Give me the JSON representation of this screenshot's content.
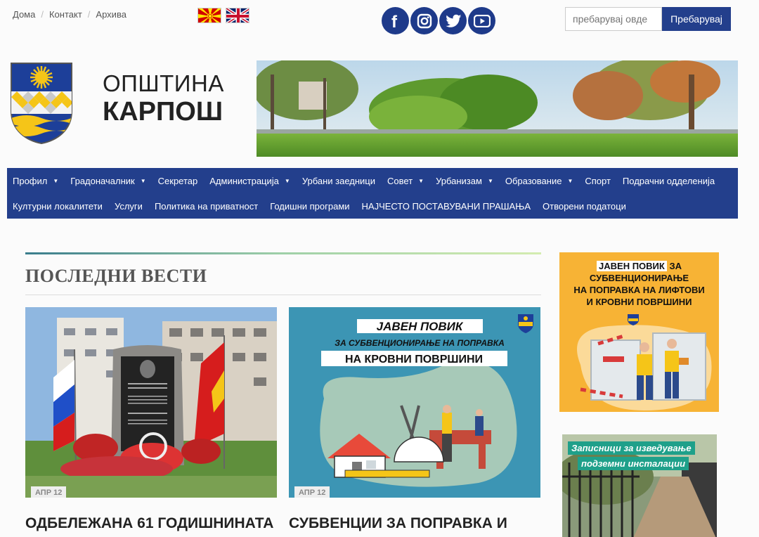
{
  "topnav": [
    "Дома",
    "Контакт",
    "Архива"
  ],
  "flags": [
    "flag-mk",
    "flag-uk"
  ],
  "social": [
    "facebook-icon",
    "instagram-icon",
    "twitter-icon",
    "youtube-icon"
  ],
  "search": {
    "placeholder": "пребарувај овде",
    "button": "Пребарувај"
  },
  "brand": {
    "line1": "ОПШТИНА",
    "line2": "КАРПОШ"
  },
  "menu": {
    "row1": [
      {
        "label": "Профил",
        "caret": true
      },
      {
        "label": "Градоначалник",
        "caret": true
      },
      {
        "label": "Секретар",
        "caret": false
      },
      {
        "label": "Администрација",
        "caret": true
      },
      {
        "label": "Урбани заедници",
        "caret": false
      },
      {
        "label": "Совет",
        "caret": true
      },
      {
        "label": "Урбанизам",
        "caret": true
      },
      {
        "label": "Образование",
        "caret": true
      },
      {
        "label": "Спорт",
        "caret": false
      },
      {
        "label": "Подрачни одделенија",
        "caret": false
      }
    ],
    "row2": [
      {
        "label": "Културни локалитети",
        "caret": false
      },
      {
        "label": "Услуги",
        "caret": false
      },
      {
        "label": "Политика на приватност",
        "caret": false
      },
      {
        "label": "Годишни програми",
        "caret": false
      },
      {
        "label": "НАЈЧЕСТО ПОСТАВУВАНИ ПРАШАЊА",
        "caret": false
      },
      {
        "label": "Отворени податоци",
        "caret": false
      }
    ]
  },
  "news": {
    "title": "ПОСЛЕДНИ ВЕСТИ",
    "cards": [
      {
        "date": "АПР 12",
        "headline": "ОДБЕЛЕЖАНА 61 ГОДИШНИНАТА"
      },
      {
        "date": "АПР 12",
        "headline": "СУБВЕНЦИИ ЗА ПОПРАВКА И",
        "poster": {
          "l1": "ЈАВЕН ПОВИК",
          "l2": "ЗА СУБВЕНЦИОНИРАЊЕ НА ПОПРАВКА",
          "l3": "НА КРОВНИ ПОВРШИНИ"
        }
      }
    ]
  },
  "sidebar": {
    "ad1": {
      "l1a": "ЈАВЕН ПОВИК",
      "l1b": " ЗА СУБВЕНЦИОНИРАЊЕ",
      "l2": "НА ПОПРАВКА НА ЛИФТОВИ",
      "l3": "И КРОВНИ ПОВРШИНИ"
    },
    "ad2": {
      "l1": "Записници за изведување",
      "l2": "подземни инсталации"
    }
  },
  "colors": {
    "primary": "#233f8c",
    "social": "#1e3a8a",
    "ad_orange": "#f7b335",
    "poster_blue": "#3c95b4"
  }
}
